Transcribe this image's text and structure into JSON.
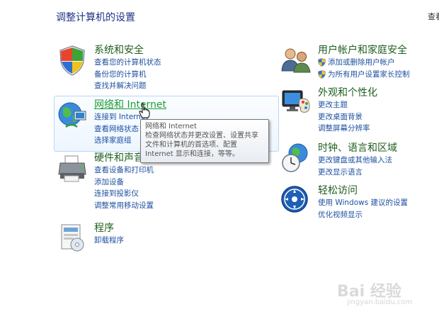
{
  "page_title": "调整计算机的设置",
  "view_by": "查看",
  "categories": {
    "system_security": {
      "title": "系统和安全",
      "icon": "shield-flag-icon",
      "links": [
        "查看您的计算机状态",
        "备份您的计算机",
        "查找并解决问题"
      ]
    },
    "network_internet": {
      "title": "网络和 Internet",
      "icon": "network-globe-icon",
      "links": [
        "连接到 Internet",
        "查看网络状态",
        "选择家庭组"
      ]
    },
    "hardware_sound": {
      "title": "硬件和声音",
      "icon": "printer-icon",
      "links": [
        "查看设备和打印机",
        "添加设备",
        "连接到投影仪",
        "调整常用移动设置"
      ]
    },
    "programs": {
      "title": "程序",
      "icon": "programs-icon",
      "links": [
        "卸载程序"
      ]
    },
    "user_accounts": {
      "title": "用户帐户和家庭安全",
      "icon": "users-icon",
      "links": [
        "添加或删除用户帐户",
        "为所有用户设置家长控制"
      ]
    },
    "appearance": {
      "title": "外观和个性化",
      "icon": "monitor-palette-icon",
      "links": [
        "更改主题",
        "更改桌面背景",
        "调整屏幕分辨率"
      ]
    },
    "clock_region": {
      "title": "时钟、语言和区域",
      "icon": "clock-globe-icon",
      "links": [
        "更改键盘或其他输入法",
        "更改显示语言"
      ]
    },
    "ease_access": {
      "title": "轻松访问",
      "icon": "ease-of-access-icon",
      "links": [
        "使用 Windows 建议的设置",
        "优化视频显示"
      ]
    }
  },
  "tooltip": {
    "title": "网络和 Internet",
    "lines": [
      "检查网络状态并更改设置、设置共享",
      "文件和计算机的首选项、配置",
      "Internet 显示和连接，等等。"
    ]
  },
  "watermark": {
    "brand": "Bai 经验",
    "url": "jingyan.baidu.com"
  }
}
